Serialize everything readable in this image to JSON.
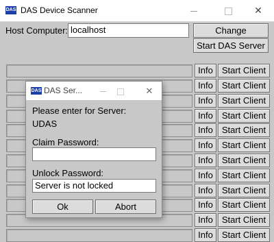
{
  "window": {
    "title": "DAS Device Scanner",
    "icon_text": "DAS",
    "minimize_glyph": "",
    "maximize_glyph": "",
    "close_glyph": "✕"
  },
  "host": {
    "label": "Host Computer:",
    "value": "localhost",
    "change_label": "Change",
    "start_server_label": "Start DAS Server"
  },
  "rows": {
    "info_label": "Info",
    "start_client_label": "Start Client"
  },
  "dialog": {
    "title": "DAS Ser...",
    "icon_text": "DAS",
    "close_glyph": "✕",
    "prompt": "Please enter for Server:",
    "server_name": "UDAS",
    "claim_label": "Claim Password:",
    "claim_value": "",
    "unlock_label": "Unlock Password:",
    "unlock_value": "Server is not locked",
    "ok_label": "Ok",
    "abort_label": "Abort"
  }
}
